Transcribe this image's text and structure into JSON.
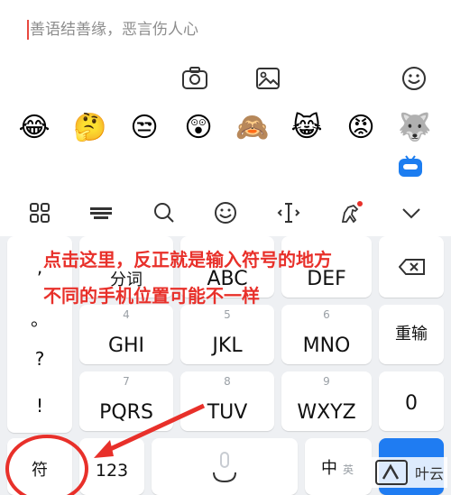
{
  "comment": {
    "placeholder": "善语结善缘，恶言伤人心"
  },
  "toolbar": {
    "icons": [
      "camera-icon",
      "image-icon",
      "emoji-icon"
    ]
  },
  "emoji_row": {
    "items": [
      "😂",
      "🤔",
      "😒",
      "😲",
      "🙈",
      "😹",
      "😡",
      "🐺"
    ]
  },
  "keyboard_bar": {
    "icons": [
      "grid-icon",
      "keyboard-icon",
      "search-icon",
      "smile-icon",
      "cursor-icon",
      "horse-icon",
      "chevron-down-icon"
    ]
  },
  "keyboard": {
    "symbols": [
      ",",
      "。",
      "?",
      "!"
    ],
    "row1": [
      {
        "num": "",
        "label": "分词"
      },
      {
        "num": "",
        "label": "ABC"
      },
      {
        "num": "",
        "label": "DEF"
      }
    ],
    "row2": [
      {
        "num": "4",
        "label": "GHI"
      },
      {
        "num": "5",
        "label": "JKL"
      },
      {
        "num": "6",
        "label": "MNO"
      }
    ],
    "row3": [
      {
        "num": "7",
        "label": "PQRS"
      },
      {
        "num": "8",
        "label": "TUV"
      },
      {
        "num": "9",
        "label": "WXYZ"
      }
    ],
    "right": {
      "delete": "",
      "reenter": "重输",
      "zero": "0"
    },
    "bottom": {
      "fu": "符",
      "num123": "123",
      "zh": "中",
      "en": "英"
    }
  },
  "annotation": {
    "line1": "点击这里，反正就是输入符号的地方",
    "line2": "不同的手机位置可能不一样"
  },
  "watermark": {
    "text": "叶云"
  }
}
